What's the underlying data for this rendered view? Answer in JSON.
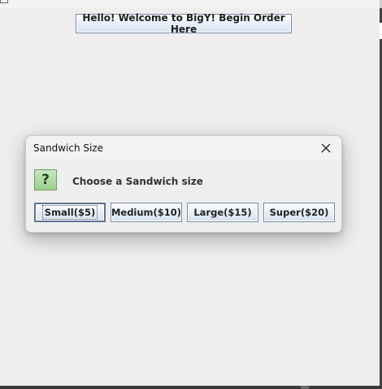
{
  "main": {
    "welcome_button_label": "Hello! Welcome to BigY! Begin Order Here"
  },
  "dialog": {
    "title": "Sandwich Size",
    "close_icon": "close-icon",
    "question_icon": "question-icon",
    "question_glyph": "?",
    "message": "Choose a Sandwich size",
    "options": [
      {
        "label": "Small($5)",
        "default": true
      },
      {
        "label": "Medium($10)"
      },
      {
        "label": "Large($15)"
      },
      {
        "label": "Super($20)"
      }
    ]
  },
  "colors": {
    "background": "#eeeeee",
    "button_border": "#7a8aa3",
    "question_icon_fill": "#9ccf8e"
  }
}
